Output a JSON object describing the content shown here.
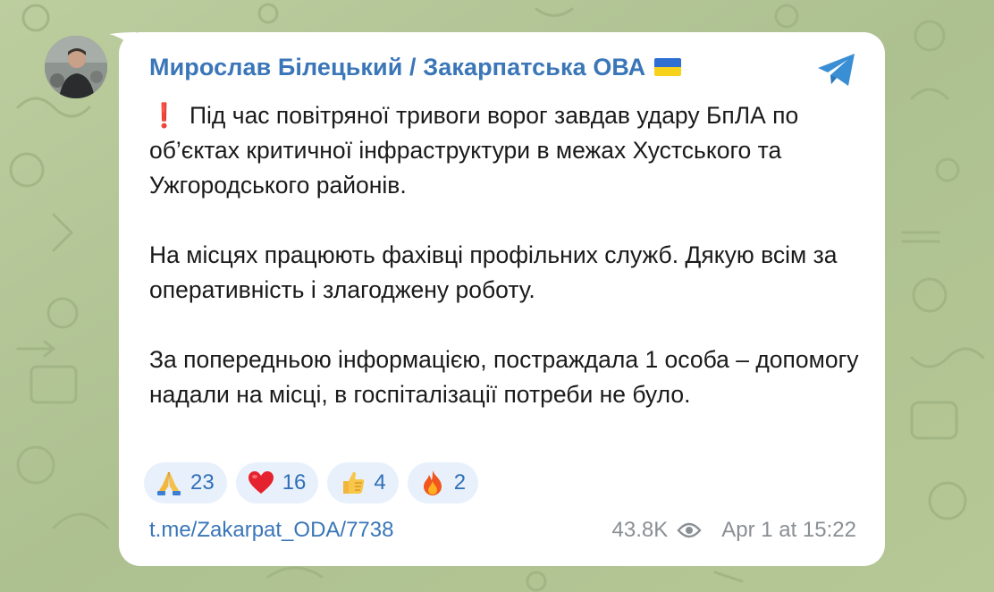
{
  "post": {
    "author": "Мирослав Білецький / Закарпатська ОВА",
    "flag_icon": "ukraine-flag-icon",
    "exclamation": "❗",
    "paragraph1": "Під час повітряної тривоги ворог завдав удару БпЛА по об’єктах критичної інфраструктури в межах Хустського та Ужгородського районів.",
    "paragraph2": "На місцях працюють фахівці профільних служб. Дякую всім за оперативність і злагоджену роботу.",
    "paragraph3": "За попередньою інформацією, постраждала 1 особа – допомогу надали на місці, в госпіталізації потреби не було.",
    "reactions": [
      {
        "icon": "folded-hands-icon",
        "count": "23"
      },
      {
        "icon": "red-heart-icon",
        "count": "16"
      },
      {
        "icon": "thumbs-up-icon",
        "count": "4"
      },
      {
        "icon": "fire-icon",
        "count": "2"
      }
    ],
    "link": "t.me/Zakarpat_ODA/7738",
    "views": "43.8K",
    "timestamp": "Apr 1 at 15:22"
  },
  "colors": {
    "background": "#b8c99a",
    "author": "#3a76b8",
    "link": "#3a76b8",
    "reaction_bg": "#e8f1fb",
    "meta": "#8a8f94"
  }
}
